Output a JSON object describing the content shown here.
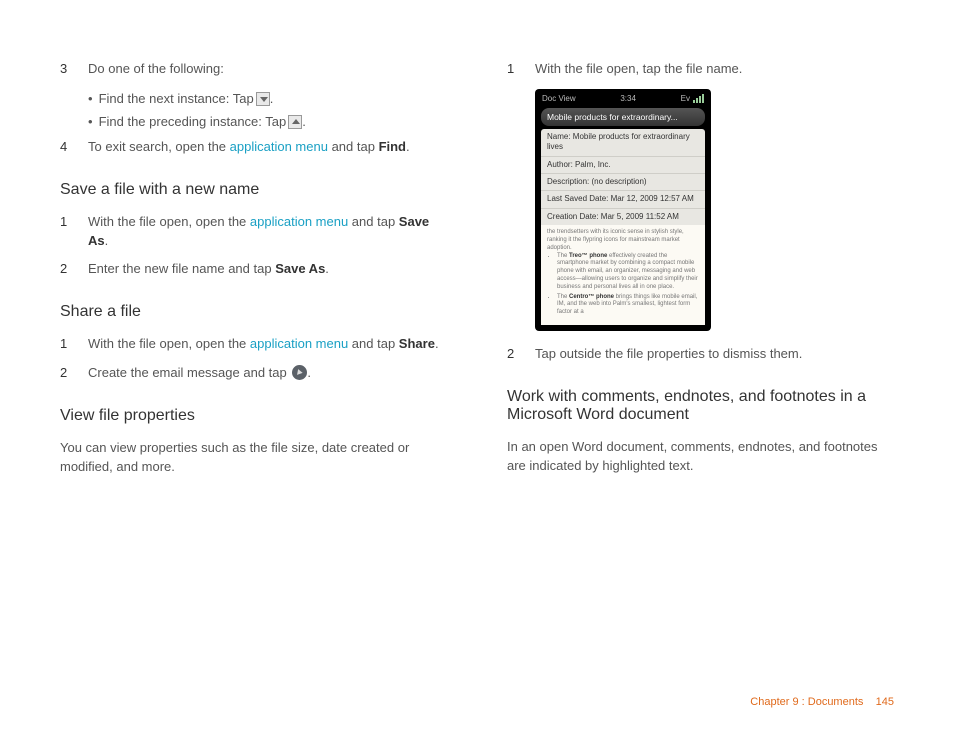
{
  "left": {
    "step3": {
      "num": "3",
      "text": "Do one of the following:"
    },
    "sub1": "Find the next instance: Tap ",
    "sub2": "Find the preceding instance: Tap ",
    "step4": {
      "num": "4",
      "pre": "To exit search, open the ",
      "link": "application menu",
      "mid": " and tap ",
      "bold": "Find",
      "post": "."
    },
    "h_save": "Save a file with a new name",
    "save_step1": {
      "num": "1",
      "pre": "With the file open, open the ",
      "link": "application menu",
      "mid": " and tap ",
      "bold": "Save As",
      "post": "."
    },
    "save_step2": {
      "num": "2",
      "pre": "Enter the new file name and tap ",
      "bold": "Save As",
      "post": "."
    },
    "h_share": "Share a file",
    "share_step1": {
      "num": "1",
      "pre": "With the file open, open the ",
      "link": "application menu",
      "mid": " and tap ",
      "bold": "Share",
      "post": "."
    },
    "share_step2": {
      "num": "2",
      "text": "Create the email message and tap "
    },
    "h_view": "View file properties",
    "view_para": "You can view properties such as the file size, date created or modified, and more."
  },
  "right": {
    "step1": {
      "num": "1",
      "text": "With the file open, tap the file name."
    },
    "phone": {
      "app": "Doc View",
      "time": "3:34",
      "net": "Ev",
      "title": "Mobile products for extraordinary...",
      "r1": "Name: Mobile products for extraordinary lives",
      "r2": "Author: Palm, Inc.",
      "r3": "Description: (no description)",
      "r4": "Last Saved Date: Mar 12, 2009 12:57 AM",
      "r5": "Creation Date: Mar 5, 2009 11:52 AM",
      "doc_intro": "the trendsetters with its iconic sense in stylish style, ranking it the flypring icons for mainstream market adoption.",
      "doc_b1_pre": "The ",
      "doc_b1_bold": "Treo™ phone",
      "doc_b1_post": " effectively created the smartphone market by combining a compact mobile phone with email, an organizer, messaging and web access—allowing users to organize and simplify their business and personal lives all in one place.",
      "doc_b2_pre": "The ",
      "doc_b2_bold": "Centro™ phone",
      "doc_b2_post": " brings things like mobile email, IM, and the web into Palm's smallest, lightest form factor at a"
    },
    "step2": {
      "num": "2",
      "text": "Tap outside the file properties to dismiss them."
    },
    "h_comments": "Work with comments, endnotes, and footnotes in a Microsoft Word document",
    "comments_para": "In an open Word document, comments, endnotes, and footnotes are indicated by highlighted text."
  },
  "footer": {
    "chapter": "Chapter 9 : Documents",
    "page": "145"
  }
}
